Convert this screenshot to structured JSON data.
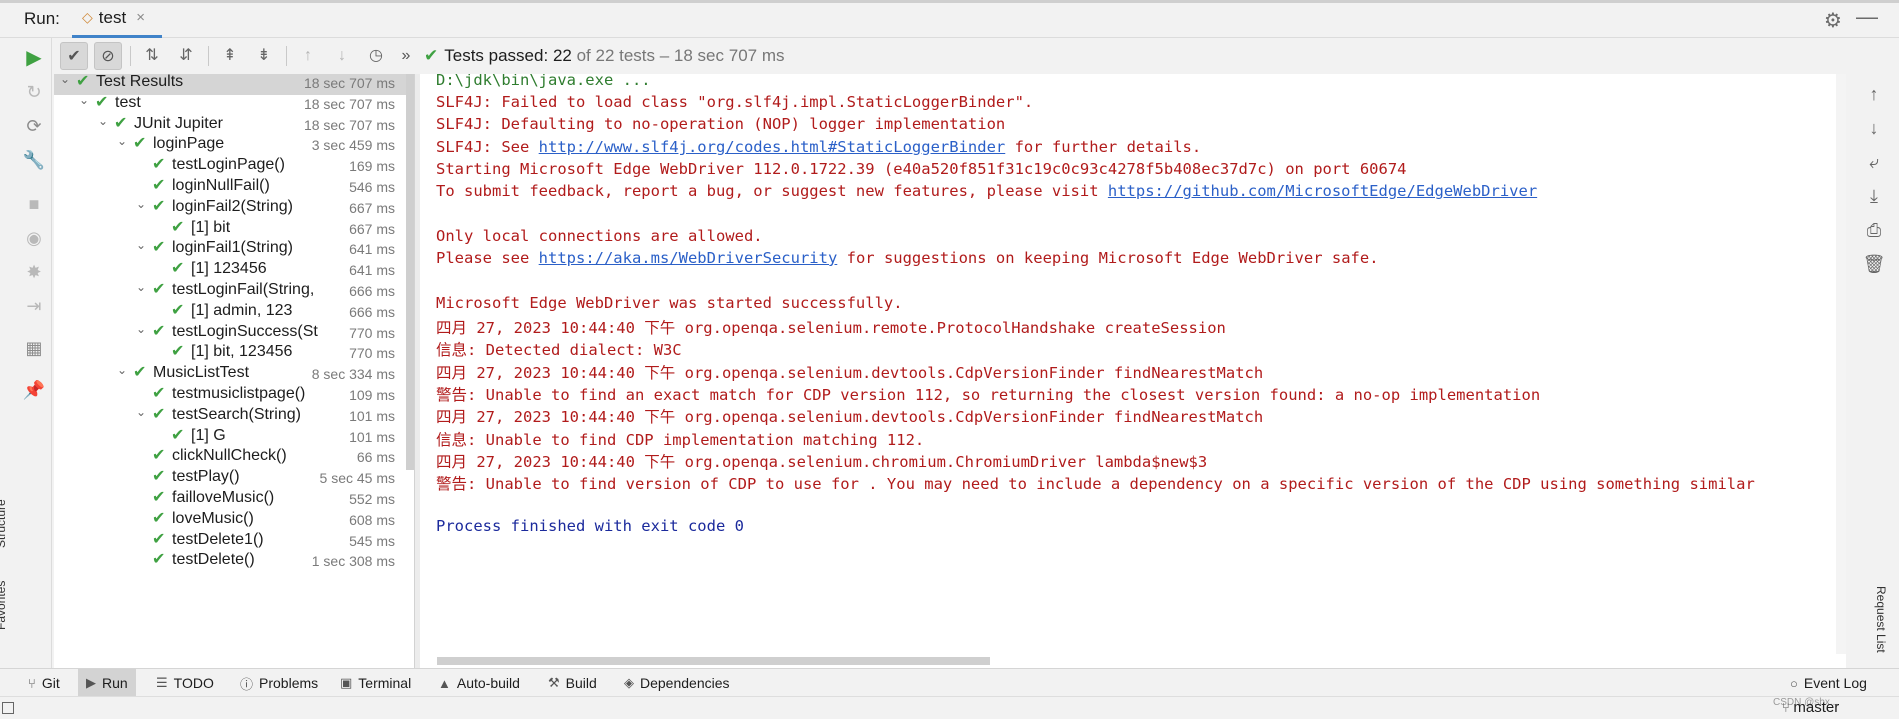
{
  "header": {
    "run_label": "Run:",
    "tab_label": "test",
    "tab_close": "×",
    "settings_icon": "gear-icon",
    "minimize_icon": "minimize-icon"
  },
  "toolbar": {
    "more_glyph": "»",
    "status_prefix": "Tests passed:",
    "status_count": "22",
    "status_suffix": "of 22 tests – 18 sec 707 ms"
  },
  "left_strip": {
    "structure_label": "Structure",
    "favorites_label": "Favorites"
  },
  "tree": {
    "rows": [
      {
        "name": "Test Results",
        "time": "18 sec 707 ms"
      },
      {
        "name": "test",
        "time": "18 sec 707 ms"
      },
      {
        "name": "JUnit Jupiter",
        "time": "18 sec 707 ms"
      },
      {
        "name": "loginPage",
        "time": "3 sec 459 ms"
      },
      {
        "name": "testLoginPage()",
        "time": "169 ms"
      },
      {
        "name": "loginNullFail()",
        "time": "546 ms"
      },
      {
        "name": "loginFail2(String)",
        "time": "667 ms"
      },
      {
        "name": "[1] bit",
        "time": "667 ms"
      },
      {
        "name": "loginFail1(String)",
        "time": "641 ms"
      },
      {
        "name": "[1] 123456",
        "time": "641 ms"
      },
      {
        "name": "testLoginFail(String,",
        "time": "666 ms"
      },
      {
        "name": "[1] admin, 123",
        "time": "666 ms"
      },
      {
        "name": "testLoginSuccess(St",
        "time": "770 ms"
      },
      {
        "name": "[1] bit, 123456",
        "time": "770 ms"
      },
      {
        "name": "MusicListTest",
        "time": "8 sec 334 ms"
      },
      {
        "name": "testmusiclistpage()",
        "time": "109 ms"
      },
      {
        "name": "testSearch(String)",
        "time": "101 ms"
      },
      {
        "name": "[1] G",
        "time": "101 ms"
      },
      {
        "name": "clickNullCheck()",
        "time": "66 ms"
      },
      {
        "name": "testPlay()",
        "time": "5 sec 45 ms"
      },
      {
        "name": "failloveMusic()",
        "time": "552 ms"
      },
      {
        "name": "loveMusic()",
        "time": "608 ms"
      },
      {
        "name": "testDelete1()",
        "time": "545 ms"
      },
      {
        "name": "testDelete()",
        "time": "1 sec 308 ms"
      }
    ]
  },
  "console": {
    "l1": "D:\\jdk\\bin\\java.exe ...",
    "l2": "SLF4J: Failed to load class \"org.slf4j.impl.StaticLoggerBinder\".",
    "l3": "SLF4J: Defaulting to no-operation (NOP) logger implementation",
    "l4_pre": "SLF4J: See ",
    "l4_link": "http://www.slf4j.org/codes.html#StaticLoggerBinder",
    "l4_post": " for further details.",
    "l5": "Starting Microsoft Edge WebDriver 112.0.1722.39 (e40a520f851f31c19c0c93c4278f5b408ec37d7c) on port 60674",
    "l6_pre": "To submit feedback, report a bug, or suggest new features, please visit ",
    "l6_link": "https://github.com/MicrosoftEdge/EdgeWebDriver",
    "l7": "Only local connections are allowed.",
    "l8_pre": "Please see ",
    "l8_link": "https://aka.ms/WebDriverSecurity",
    "l8_post": " for suggestions on keeping Microsoft Edge WebDriver safe.",
    "l9": "Microsoft Edge WebDriver was started successfully.",
    "l10": "四月 27, 2023 10:44:40 下午 org.openqa.selenium.remote.ProtocolHandshake createSession",
    "l11": "信息: Detected dialect: W3C",
    "l12": "四月 27, 2023 10:44:40 下午 org.openqa.selenium.devtools.CdpVersionFinder findNearestMatch",
    "l13": "警告: Unable to find an exact match for CDP version 112, so returning the closest version found: a no-op implementation",
    "l14": "四月 27, 2023 10:44:40 下午 org.openqa.selenium.devtools.CdpVersionFinder findNearestMatch",
    "l15": "信息: Unable to find CDP implementation matching 112.",
    "l16": "四月 27, 2023 10:44:40 下午 org.openqa.selenium.chromium.ChromiumDriver lambda$new$3",
    "l17": "警告: Unable to find version of CDP to use for . You may need to include a dependency on a specific version of the CDP using something similar",
    "l18": "Process finished with exit code 0"
  },
  "right_col": {
    "vertical_label": "Request List"
  },
  "bottom_bar": {
    "git": "Git",
    "run": "Run",
    "todo": "TODO",
    "problems": "Problems",
    "terminal": "Terminal",
    "autobuild": "Auto-build",
    "build": "Build",
    "dependencies": "Dependencies",
    "eventlog": "Event Log"
  },
  "status_bar": {
    "branch": "master",
    "watermark": "CSDN @sbx..."
  },
  "colors": {
    "pass_green": "#3fa142",
    "console_red": "#b11b1b",
    "link_blue": "#2b60c8",
    "exit_blue": "#1b2a9c"
  }
}
